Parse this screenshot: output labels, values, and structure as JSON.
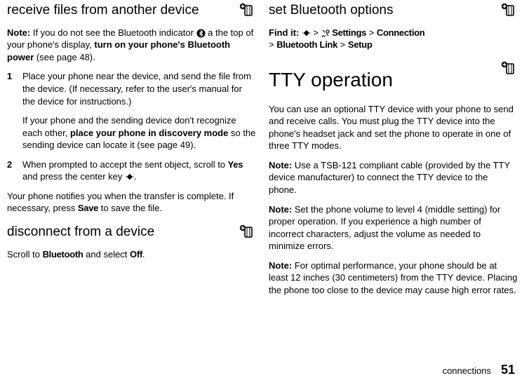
{
  "left": {
    "h_receive": "receive files from another device",
    "note1_a": "Note:",
    "note1_b": " If you do not see the Bluetooth indicator ",
    "note1_c": " a the top of your phone's display, ",
    "note1_d": "turn on your phone's Bluetooth power",
    "note1_e": " (see page 48).",
    "li1a": "Place your phone near the device, and send the file from the device. (If necessary, refer to the user's manual for the device for instructions.)",
    "li1b_a": "If your phone and the sending device don't recognize each other, ",
    "li1b_b": "place your phone in discovery mode",
    "li1b_c": " so the sending device can locate it (see page 49).",
    "li2_a": "When prompted to accept the sent object, scroll to ",
    "li2_yes": "Yes",
    "li2_b": " and press the center key ",
    "li2_c": ".",
    "notify_a": "Your phone notifies you when the transfer is complete. If necessary, press ",
    "notify_save": "Save",
    "notify_b": " to save the file.",
    "h_disconnect": "disconnect from a device",
    "disc_a": "Scroll to ",
    "disc_bt": "Bluetooth",
    "disc_b": " and select ",
    "disc_off": "Off",
    "disc_c": "."
  },
  "right": {
    "h_set": "set Bluetooth options",
    "find_a": "Find it:",
    "find_key": " ",
    "find_gt1": " > ",
    "find_settings": "Settings",
    "find_gt2": " > ",
    "find_conn": "Connection",
    "find_gt3": " > ",
    "find_btlink": "Bluetooth Link",
    "find_gt4": " > ",
    "find_setup": "Setup",
    "h_tty": "TTY operation",
    "tty_p1": "You can use an optional TTY device with your phone to send and receive calls. You must plug the TTY device into the phone's headset jack and set the phone to operate in one of three TTY modes.",
    "tty_n1a": "Note:",
    "tty_n1b": " Use a TSB-121 compliant cable (provided by the TTY device manufacturer) to connect the TTY device to the phone.",
    "tty_n2a": "Note:",
    "tty_n2b": " Set the phone volume to level 4 (middle setting) for proper operation. If you experience a high number of incorrect characters, adjust the volume as needed to minimize errors.",
    "tty_n3a": "Note:",
    "tty_n3b": " For optimal performance, your phone should be at least 12 inches (30 centimeters) from the TTY device. Placing the phone too close to the device may cause high error rates."
  },
  "footer": {
    "section": "connections",
    "page": "51"
  }
}
